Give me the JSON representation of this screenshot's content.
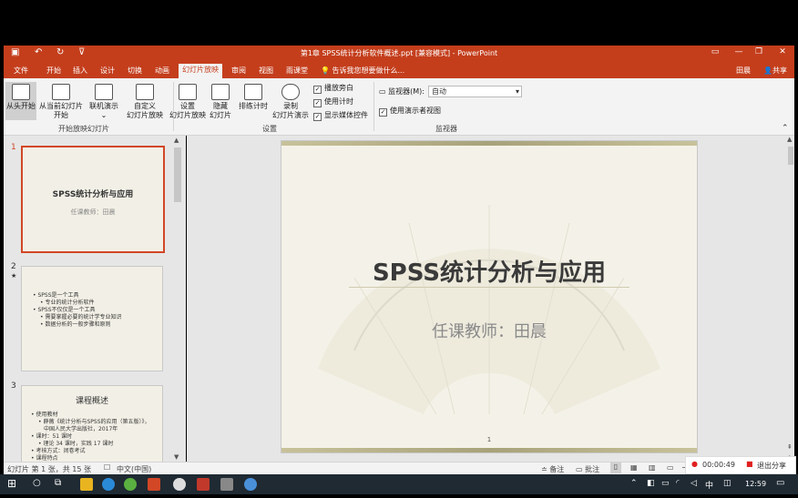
{
  "window": {
    "title": "第1章 SPSS统计分析软件概述.ppt [兼容模式] - PowerPoint",
    "user": "田晨",
    "share": "共享"
  },
  "tabs": [
    "文件",
    "开始",
    "插入",
    "设计",
    "切换",
    "动画",
    "幻灯片放映",
    "审阅",
    "视图",
    "雨课堂"
  ],
  "active_tab": "幻灯片放映",
  "tell_me": "告诉我您想要做什么...",
  "ribbon": {
    "start_group": {
      "label": "开始放映幻灯片",
      "from_beginning": "从头开始",
      "from_current_1": "从当前幻灯片",
      "from_current_2": "开始",
      "online_1": "联机演示",
      "custom_1": "自定义",
      "custom_2": "幻灯片放映"
    },
    "setup_group": {
      "label": "设置",
      "setup_1": "设置",
      "setup_2": "幻灯片放映",
      "hide_1": "隐藏",
      "hide_2": "幻灯片",
      "rehearse": "排练计时",
      "record_1": "录制",
      "record_2": "幻灯片演示",
      "play_narration": "播放旁白",
      "use_timings": "使用计时",
      "show_media": "显示媒体控件"
    },
    "monitor_group": {
      "label": "监视器",
      "monitor_label": "监视器(M):",
      "monitor_value": "自动",
      "presenter_view": "使用演示者视图"
    }
  },
  "thumbnails": [
    {
      "number": "1",
      "title": "SPSS统计分析与应用",
      "sub": "任课教师：田晨"
    },
    {
      "number": "2",
      "star": "★",
      "bullets": [
        "SPSS是一个工具",
        "专业的统计分析软件",
        "SPSS不仅仅是一个工具",
        "需要掌握必要的统计学专业知识",
        "数据分析的一般步骤和原则"
      ]
    },
    {
      "number": "3",
      "title": "课程概述",
      "bullets": [
        "使用教材",
        "薛薇《统计分析与SPSS的应用（第五版）》，",
        "中国人民大学出版社，2017年",
        "课时：51 课时",
        "理论 34 课时，实践 17 课时",
        "考核方式：闭卷考试",
        "课程特点"
      ]
    }
  ],
  "slide": {
    "title": "SPSS统计分析与应用",
    "subtitle": "任课教师：田晨",
    "page_number": "1"
  },
  "status": {
    "slide_info": "幻灯片 第 1 张，共 15 张",
    "language": "中文(中国)",
    "notes": "备注",
    "comments": "批注",
    "zoom": "56%"
  },
  "recording": {
    "time": "00:00:49",
    "exit": "退出分享"
  },
  "taskbar": {
    "ime": "中",
    "clock": "12:59"
  }
}
